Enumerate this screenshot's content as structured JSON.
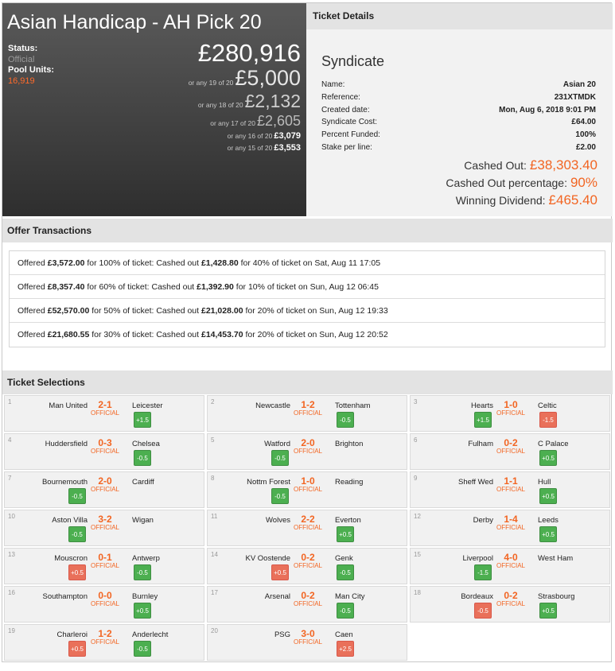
{
  "hero": {
    "title": "Asian Handicap - AH Pick 20",
    "status_label": "Status:",
    "status_value": "Official",
    "pool_units_label": "Pool Units:",
    "pool_units_value": "16,919",
    "main_prize": "£280,916",
    "prize_tiers": [
      {
        "prefix": "or any 19 of 20",
        "amount": "£5,000"
      },
      {
        "prefix": "or any 18 of 20",
        "amount": "£2,132"
      },
      {
        "prefix": "or any 17 of 20",
        "amount": "£2,605"
      },
      {
        "prefix": "or any 16 of 20",
        "amount": "£3,079"
      },
      {
        "prefix": "or any 15 of 20",
        "amount": "£3,553"
      }
    ]
  },
  "details": {
    "header": "Ticket Details",
    "syndicate_title": "Syndicate",
    "rows": [
      {
        "label": "Name:",
        "value": "Asian 20"
      },
      {
        "label": "Reference:",
        "value": "231XTMDK"
      },
      {
        "label": "Created date:",
        "value": "Mon, Aug 6, 2018 9:01 PM"
      },
      {
        "label": "Syndicate Cost:",
        "value": "£64.00"
      },
      {
        "label": "Percent Funded:",
        "value": "100%"
      },
      {
        "label": "Stake per line:",
        "value": "£2.00"
      }
    ],
    "cashed_out_label": "Cashed Out:",
    "cashed_out_value": "£38,303.40",
    "cashed_out_pct_label": "Cashed Out percentage:",
    "cashed_out_pct_value": "90%",
    "winning_dividend_label": "Winning Dividend:",
    "winning_dividend_value": "£465.40"
  },
  "offers": {
    "header": "Offer Transactions",
    "items": [
      {
        "t1": "Offered ",
        "offer": "£3,572.00",
        "t2": " for 100% of ticket: Cashed out ",
        "cash": "£1,428.80",
        "t3": " for 40% of ticket on Sat, Aug 11 17:05"
      },
      {
        "t1": "Offered ",
        "offer": "£8,357.40",
        "t2": " for 60% of ticket: Cashed out ",
        "cash": "£1,392.90",
        "t3": " for 10% of ticket on Sun, Aug 12 06:45"
      },
      {
        "t1": "Offered ",
        "offer": "£52,570.00",
        "t2": " for 50% of ticket: Cashed out ",
        "cash": "£21,028.00",
        "t3": " for 20% of ticket on Sun, Aug 12 19:33"
      },
      {
        "t1": "Offered ",
        "offer": "£21,680.55",
        "t2": " for 30% of ticket: Cashed out ",
        "cash": "£14,453.70",
        "t3": " for 20% of ticket on Sun, Aug 12 20:52"
      }
    ]
  },
  "selections": {
    "header": "Ticket Selections",
    "official_label": "OFFICIAL",
    "colors": {
      "win": "#4caf50",
      "loss": "#e9705a",
      "score": "#f26522"
    },
    "items": [
      {
        "n": "1",
        "home": "Man United",
        "score": "2-1",
        "away": "Leicester",
        "hcap": "+1.5",
        "side": "a",
        "result": "win"
      },
      {
        "n": "2",
        "home": "Newcastle",
        "score": "1-2",
        "away": "Tottenham",
        "hcap": "-0.5",
        "side": "a",
        "result": "win"
      },
      {
        "n": "3",
        "home": "Hearts",
        "score": "1-0",
        "away": "Celtic",
        "hcap": "+1.5",
        "side": "h",
        "result": "win",
        "hcap2": "-1.5",
        "result2": "loss"
      },
      {
        "n": "4",
        "home": "Huddersfield",
        "score": "0-3",
        "away": "Chelsea",
        "hcap": "-0.5",
        "side": "a",
        "result": "win"
      },
      {
        "n": "5",
        "home": "Watford",
        "score": "2-0",
        "away": "Brighton",
        "hcap": "-0.5",
        "side": "h",
        "result": "win"
      },
      {
        "n": "6",
        "home": "Fulham",
        "score": "0-2",
        "away": "C Palace",
        "hcap": "+0.5",
        "side": "a",
        "result": "win"
      },
      {
        "n": "7",
        "home": "Bournemouth",
        "score": "2-0",
        "away": "Cardiff",
        "hcap": "-0.5",
        "side": "h",
        "result": "win"
      },
      {
        "n": "8",
        "home": "Nottm Forest",
        "score": "1-0",
        "away": "Reading",
        "hcap": "-0.5",
        "side": "h",
        "result": "win"
      },
      {
        "n": "9",
        "home": "Sheff Wed",
        "score": "1-1",
        "away": "Hull",
        "hcap": "+0.5",
        "side": "a",
        "result": "win"
      },
      {
        "n": "10",
        "home": "Aston Villa",
        "score": "3-2",
        "away": "Wigan",
        "hcap": "-0.5",
        "side": "h",
        "result": "win"
      },
      {
        "n": "11",
        "home": "Wolves",
        "score": "2-2",
        "away": "Everton",
        "hcap": "+0.5",
        "side": "a",
        "result": "win"
      },
      {
        "n": "12",
        "home": "Derby",
        "score": "1-4",
        "away": "Leeds",
        "hcap": "+0.5",
        "side": "a",
        "result": "win"
      },
      {
        "n": "13",
        "home": "Mouscron",
        "score": "0-1",
        "away": "Antwerp",
        "hcap": "+0.5",
        "side": "h",
        "result": "loss",
        "hcap2": "-0.5",
        "result2": "win"
      },
      {
        "n": "14",
        "home": "KV Oostende",
        "score": "0-2",
        "away": "Genk",
        "hcap": "+0.5",
        "side": "h",
        "result": "loss",
        "hcap2": "-0.5",
        "result2": "win"
      },
      {
        "n": "15",
        "home": "Liverpool",
        "score": "4-0",
        "away": "West Ham",
        "hcap": "-1.5",
        "side": "h",
        "result": "win"
      },
      {
        "n": "16",
        "home": "Southampton",
        "score": "0-0",
        "away": "Burnley",
        "hcap": "+0.5",
        "side": "a",
        "result": "win"
      },
      {
        "n": "17",
        "home": "Arsenal",
        "score": "0-2",
        "away": "Man City",
        "hcap": "-0.5",
        "side": "a",
        "result": "win"
      },
      {
        "n": "18",
        "home": "Bordeaux",
        "score": "0-2",
        "away": "Strasbourg",
        "hcap": "-0.5",
        "side": "h",
        "result": "loss",
        "hcap2": "+0.5",
        "result2": "win"
      },
      {
        "n": "19",
        "home": "Charleroi",
        "score": "1-2",
        "away": "Anderlecht",
        "hcap": "+0.5",
        "side": "h",
        "result": "loss",
        "hcap2": "-0.5",
        "result2": "win"
      },
      {
        "n": "20",
        "home": "PSG",
        "score": "3-0",
        "away": "Caen",
        "hcap": "+2.5",
        "side": "a",
        "result": "loss"
      }
    ]
  }
}
